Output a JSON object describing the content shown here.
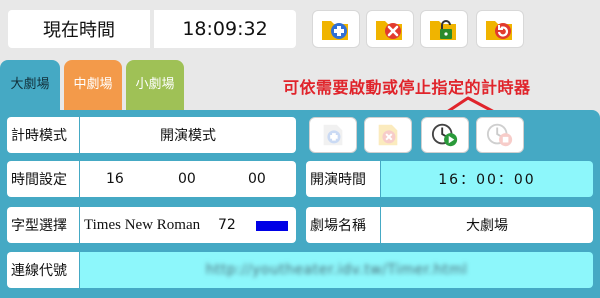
{
  "clock": {
    "label": "現在時間",
    "value": "18:09:32"
  },
  "top_buttons": [
    {
      "name": "add-file-button",
      "icon": "folder-plus-icon"
    },
    {
      "name": "delete-file-button",
      "icon": "folder-x-icon"
    },
    {
      "name": "unlock-button",
      "icon": "folder-unlock-icon"
    },
    {
      "name": "refresh-button",
      "icon": "folder-refresh-icon"
    }
  ],
  "tabs": [
    {
      "label": "大劇場",
      "active": true,
      "color": "#45a9c4"
    },
    {
      "label": "中劇場",
      "active": false,
      "color": "#f39a4a"
    },
    {
      "label": "小劇場",
      "active": false,
      "color": "#9fc156"
    }
  ],
  "annotation": "可依需要啟動或停止指定的計時器",
  "form": {
    "timer_mode": {
      "label": "計時模式",
      "value": "開演模式"
    },
    "time_setting": {
      "label": "時間設定",
      "hour": "16",
      "minute": "00",
      "second": "00"
    },
    "start_time": {
      "label": "開演時間",
      "value": "16：00：00"
    },
    "font_select": {
      "label": "字型選擇",
      "font": "Times New Roman",
      "size": "72",
      "color": "#0000e6"
    },
    "theater_name": {
      "label": "劇場名稱",
      "value": "大劇場"
    },
    "connection_code": {
      "label": "連線代號",
      "value": "http://youtheater.idv.tw/Timer.html"
    }
  },
  "colors": {
    "panel": "#45a9c4",
    "cyan_field": "#8df7fb",
    "annotation": "#e0242b"
  }
}
